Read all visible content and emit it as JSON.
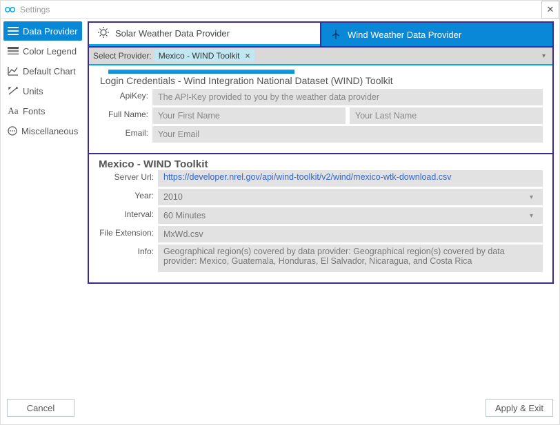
{
  "window": {
    "title": "Settings"
  },
  "sidebar": {
    "items": [
      {
        "label": "Data Provider"
      },
      {
        "label": "Color Legend"
      },
      {
        "label": "Default Chart"
      },
      {
        "label": "Units"
      },
      {
        "label": "Fonts"
      },
      {
        "label": "Miscellaneous"
      }
    ]
  },
  "tabs": {
    "solar": "Solar Weather Data Provider",
    "wind": "Wind Weather Data Provider"
  },
  "provider": {
    "select_label": "Select Provider:",
    "chip": "Mexico - WIND Toolkit",
    "login_header": "Login Credentials - Wind Integration National Dataset (WIND) Toolkit",
    "apikey": {
      "label": "ApiKey:",
      "placeholder": "The API-Key provided to you by the weather data provider"
    },
    "fullname": {
      "label": "Full Name:",
      "first_placeholder": "Your First Name",
      "last_placeholder": "Your Last Name"
    },
    "email": {
      "label": "Email:",
      "placeholder": "Your Email"
    }
  },
  "dataset": {
    "header": "Mexico - WIND Toolkit",
    "server": {
      "label": "Server Url:",
      "value": "https://developer.nrel.gov/api/wind-toolkit/v2/wind/mexico-wtk-download.csv"
    },
    "year": {
      "label": "Year:",
      "value": "2010"
    },
    "interval": {
      "label": "Interval:",
      "value": "60 Minutes"
    },
    "fileext": {
      "label": "File Extension:",
      "value": "MxWd.csv"
    },
    "info": {
      "label": "Info:",
      "value": "Geographical region(s) covered by data provider: Geographical region(s) covered by data provider: Mexico, Guatemala, Honduras, El Salvador, Nicaragua, and Costa Rica"
    }
  },
  "footer": {
    "cancel": "Cancel",
    "apply": "Apply & Exit"
  }
}
